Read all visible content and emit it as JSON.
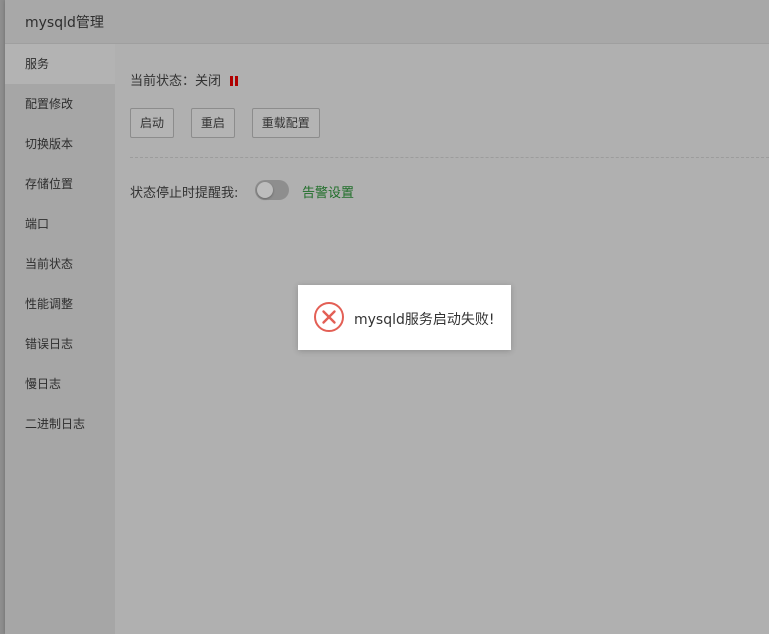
{
  "window": {
    "title": "mysqld管理"
  },
  "sidebar": {
    "items": [
      {
        "label": "服务",
        "active": true
      },
      {
        "label": "配置修改"
      },
      {
        "label": "切换版本"
      },
      {
        "label": "存储位置"
      },
      {
        "label": "端口"
      },
      {
        "label": "当前状态"
      },
      {
        "label": "性能调整"
      },
      {
        "label": "错误日志"
      },
      {
        "label": "慢日志"
      },
      {
        "label": "二进制日志"
      }
    ]
  },
  "service": {
    "status_text": "当前状态：关闭",
    "status_icon": "pause-icon",
    "status_color": "#b00000",
    "buttons": {
      "start": "启动",
      "restart": "重启",
      "reload": "重载配置"
    },
    "alert_label": "状态停止时提醒我:",
    "alert_toggle_on": false,
    "alert_settings_link": "告警设置",
    "link_color": "#1f6e29"
  },
  "toast": {
    "icon": "error-circle-icon",
    "message": "mysqld服务启动失败!",
    "icon_color": "#e35f55"
  }
}
